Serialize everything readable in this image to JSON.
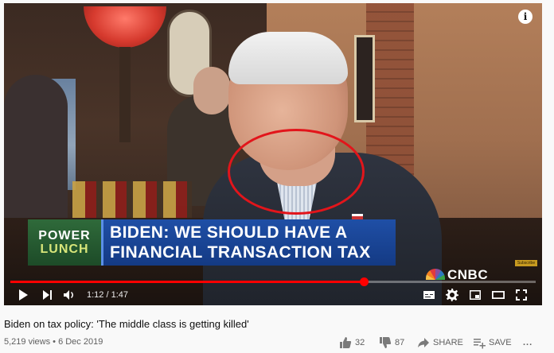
{
  "player": {
    "show_logo_top": "POWER",
    "show_logo_bottom": "LUNCH",
    "headline_line1": "BIDEN: WE SHOULD HAVE A",
    "headline_line2": "FINANCIAL TRANSACTION TAX",
    "network": "CNBC",
    "subscribe_badge": "Subscribe",
    "info_icon": "i",
    "current_time": "1:12",
    "duration": "1:47",
    "progress_fraction": 0.673
  },
  "video": {
    "title": "Biden on tax policy: 'The middle class is getting killed'",
    "views": "5,219 views",
    "date": "6 Dec 2019",
    "separator": " • "
  },
  "actions": {
    "likes": "32",
    "dislikes": "87",
    "share_label": "SHARE",
    "save_label": "SAVE",
    "more_label": "..."
  },
  "icons": {
    "play": "play-icon",
    "next": "next-icon",
    "volume": "volume-icon",
    "captions": "captions-icon",
    "settings": "gear-icon",
    "miniplayer": "miniplayer-icon",
    "theater": "theater-icon",
    "fullscreen": "fullscreen-icon",
    "like": "thumbs-up-icon",
    "dislike": "thumbs-down-icon",
    "share": "share-icon",
    "save": "playlist-add-icon",
    "more": "more-icon"
  },
  "colors": {
    "progress": "#ff0000",
    "annotation": "#e2151b",
    "headline_bg": "#1f4fa6",
    "show_logo_bg": "#2f6a3a"
  }
}
